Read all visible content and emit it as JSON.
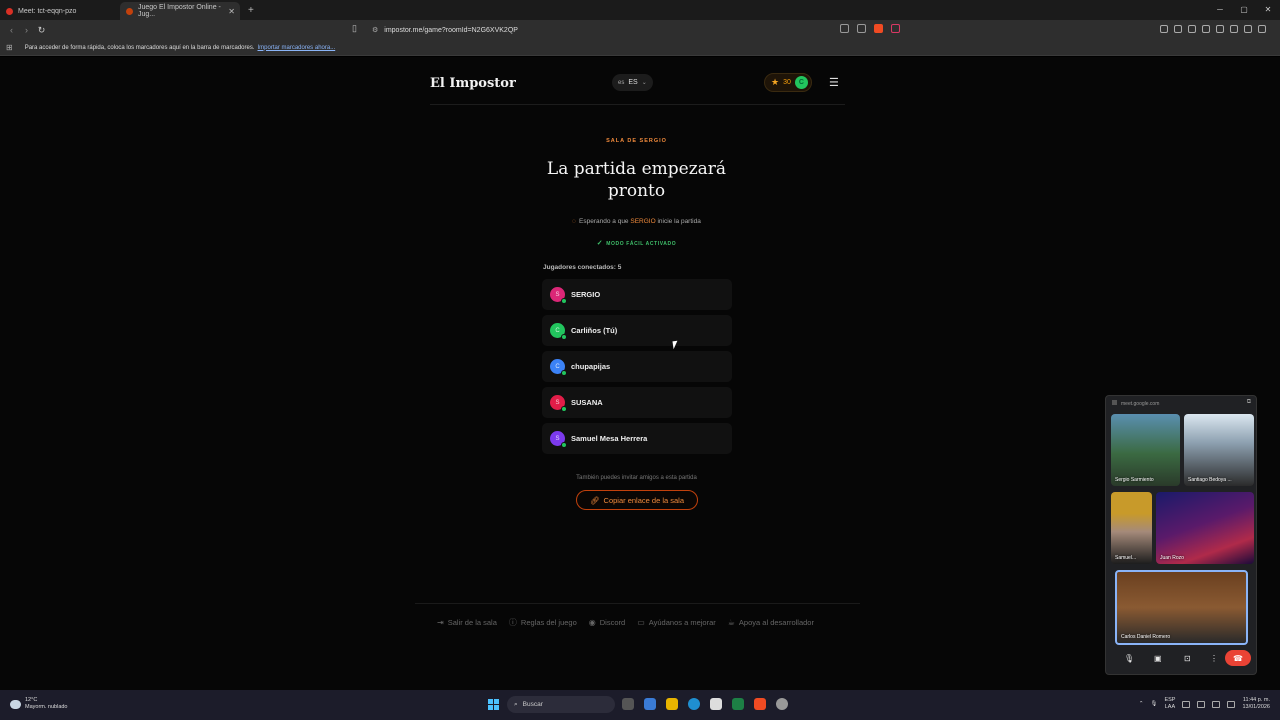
{
  "browser": {
    "tabs": [
      {
        "label": "Meet: tct-eqqn-pzo"
      },
      {
        "label": "Juego El Impostor Online - Jug..."
      }
    ],
    "new_tab": "+",
    "url": "impostor.me/game?roomId=N2G6XVK2QP",
    "bookmarks_bar_text": "Para acceder de forma rápida, coloca los marcadores aquí en la barra de marcadores.",
    "bookmarks_link": "Importar marcadores ahora..."
  },
  "header": {
    "logo": "El Impostor",
    "lang_flag": "es",
    "lang_code": "ES",
    "stars": "30",
    "avatar_initial": "C"
  },
  "lobby": {
    "subtitle": "SALA DE SERGIO",
    "title": "La partida empezará pronto",
    "waiting_prefix": "Esperando a que",
    "waiting_host": "SERGIO",
    "waiting_suffix": "inicie la partida",
    "easy_mode": "MODO FÁCIL ACTIVADO",
    "players_label": "Jugadores conectados: 5",
    "players": [
      {
        "initial": "S",
        "name": "SERGIO",
        "color": "#db2777"
      },
      {
        "initial": "C",
        "name": "Carliños (Tú)",
        "color": "#22c55e"
      },
      {
        "initial": "C",
        "name": "chupapijas",
        "color": "#3b82f6"
      },
      {
        "initial": "S",
        "name": "SUSANA",
        "color": "#e11d48"
      },
      {
        "initial": "S",
        "name": "Samuel Mesa Herrera",
        "color": "#7c3aed"
      }
    ],
    "invite_text": "También puedes invitar amigos a esta partida",
    "copy_button": "Copiar enlace de la sala"
  },
  "footer": {
    "links": [
      {
        "icon": "exit-icon",
        "label": "Salir de la sala"
      },
      {
        "icon": "info-icon",
        "label": "Reglas del juego"
      },
      {
        "icon": "discord-icon",
        "label": "Discord"
      },
      {
        "icon": "message-icon",
        "label": "Ayúdanos a mejorar"
      },
      {
        "icon": "coffee-icon",
        "label": "Apoya al desarrollador"
      }
    ]
  },
  "meet": {
    "url": "meet.google.com",
    "participants": [
      {
        "name": "Sergio Sarmiento"
      },
      {
        "name": "Santiago Bedoya ..."
      },
      {
        "name": "Samuel..."
      },
      {
        "name": "Juan Rozo"
      },
      {
        "name": "Carlos Daniel Romero"
      }
    ]
  },
  "taskbar": {
    "temp": "12°C",
    "weather": "Mayorm. nublado",
    "search": "Buscar",
    "lang_top": "ESP",
    "lang_bottom": "LAA",
    "time": "11:44 p. m.",
    "date": "13/01/2026"
  },
  "colors": {
    "accent": "#f08a3c",
    "online": "#22c55e"
  }
}
